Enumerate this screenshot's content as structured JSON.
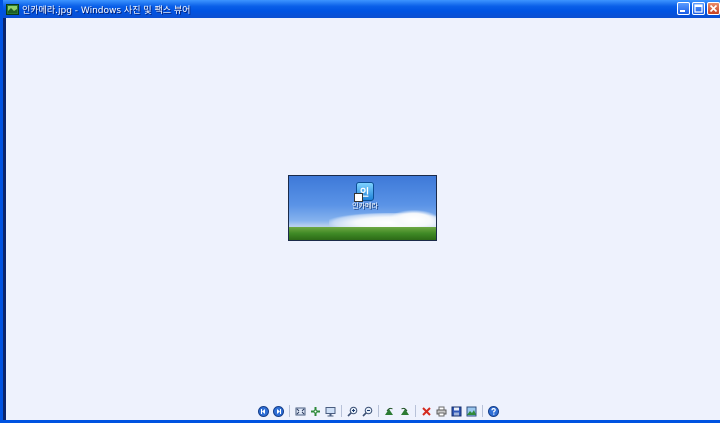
{
  "window": {
    "title": "인카메라.jpg - Windows 사진 및 팩스 뷰어",
    "buttons": [
      "minimize",
      "maximize",
      "close"
    ]
  },
  "photo": {
    "desktop_icon_label": "인카메라",
    "desktop_icon_glyph": "인"
  },
  "toolbar": {
    "icons": [
      "previous-image-icon",
      "next-image-icon",
      "best-fit-icon",
      "actual-size-icon",
      "slideshow-icon",
      "zoom-in-icon",
      "zoom-out-icon",
      "rotate-clockwise-icon",
      "rotate-counterclockwise-icon",
      "delete-icon",
      "print-icon",
      "save-copy-icon",
      "open-editor-icon",
      "help-icon"
    ]
  },
  "colors": {
    "titlebar": "#0054e3",
    "client_bg": "#eef2fd",
    "close_button": "#c8401e"
  }
}
